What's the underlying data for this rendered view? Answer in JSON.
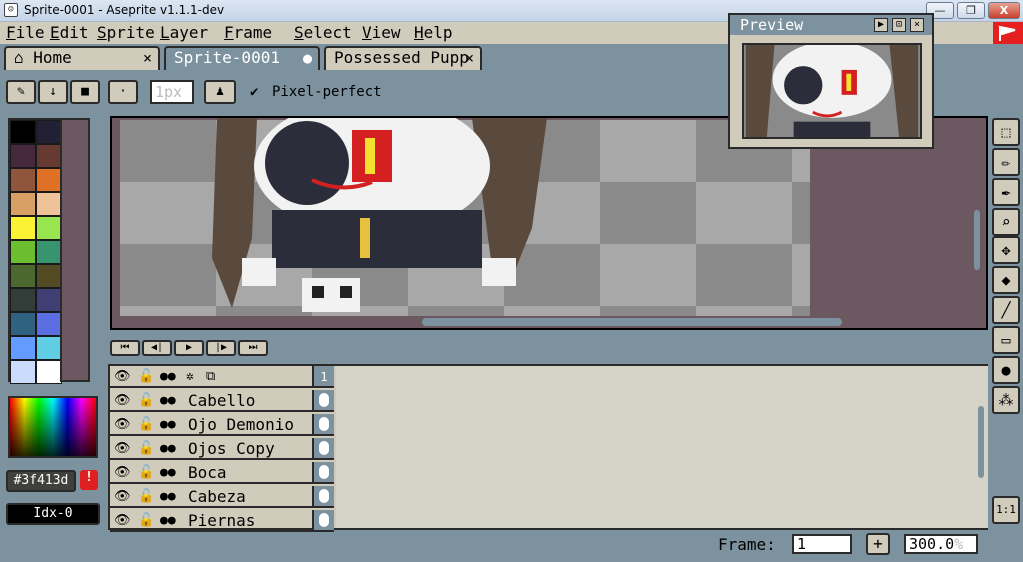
{
  "window": {
    "title": "Sprite-0001 - Aseprite v1.1.1-dev",
    "app_icon": "aseprite-icon",
    "minimize": "—",
    "maximize": "❐",
    "close": "X"
  },
  "menu": [
    "File",
    "Edit",
    "Sprite",
    "Layer",
    "Frame",
    "Select",
    "View",
    "Help"
  ],
  "tabs": [
    {
      "label": "Home",
      "icon": "home-icon",
      "close": "×"
    },
    {
      "label": "Sprite-0001",
      "close": "●"
    },
    {
      "label": "Possessed Pupp",
      "close": "×"
    }
  ],
  "tool_options": {
    "brush_size": "1px",
    "pixel_perfect_label": "Pixel-perfect",
    "pixel_perfect_checked": true
  },
  "palette": {
    "colors": [
      "#000000",
      "#222034",
      "#45283c",
      "#663931",
      "#8f563b",
      "#df7126",
      "#d9a066",
      "#eec39a",
      "#fbf236",
      "#99e550",
      "#6abe30",
      "#37946e",
      "#4b692f",
      "#524b24",
      "#323c39",
      "#3f3f74",
      "#306082",
      "#5b6ee1",
      "#639bff",
      "#5fcde4",
      "#cbdbfc",
      "#ffffff"
    ],
    "current_hex": "#3f413d",
    "warning": "!",
    "index_label": "Idx-0"
  },
  "preview": {
    "title": "Preview"
  },
  "tools": [
    "rectangular-marquee-icon",
    "pencil-icon",
    "eyedropper-icon",
    "zoom-icon",
    "move-icon",
    "paint-bucket-icon",
    "line-icon",
    "rectangle-icon",
    "blur-icon",
    "spray-icon"
  ],
  "playback": [
    "⏮",
    "◀|",
    "▶",
    "|▶",
    "⏭"
  ],
  "timeline": {
    "frame_header": "1",
    "layers": [
      "Cabello",
      "Ojo Demonio",
      "Ojos Copy",
      "Boca",
      "Cabeza",
      "Piernas"
    ]
  },
  "status": {
    "frame_label": "Frame:",
    "frame_value": "1",
    "add_frame": "+",
    "zoom": "300.0",
    "zoom_unit": "%",
    "zoom_reset": "1:1"
  },
  "colors": {
    "accent": "#7d929f",
    "panel": "#d1cbbc",
    "canvas_bg": "#6b5860"
  }
}
